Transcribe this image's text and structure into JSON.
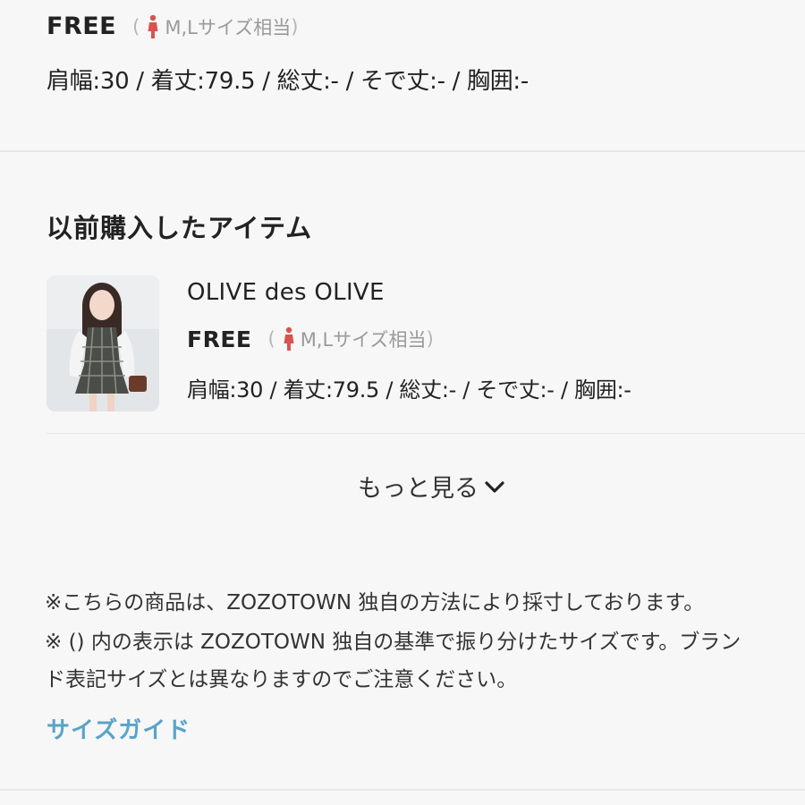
{
  "top_item": {
    "size": "FREE",
    "equiv_open": "(",
    "equiv_text": "M,Lサイズ相当",
    "equiv_close": ")",
    "measurements": "肩幅:30 / 着丈:79.5 / 総丈:- / そで丈:- / 胸囲:-"
  },
  "previous": {
    "title": "以前購入したアイテム",
    "item": {
      "brand": "OLIVE des OLIVE",
      "size": "FREE",
      "equiv_open": "(",
      "equiv_text": "M,Lサイズ相当",
      "equiv_close": ")",
      "measurements": "肩幅:30 / 着丈:79.5 / 総丈:- / そで丈:- / 胸囲:-"
    },
    "more_label": "もっと見る"
  },
  "notes": {
    "line1": "※こちらの商品は、ZOZOTOWN 独自の方法により採寸しております。",
    "line2": "※ () 内の表示は ZOZOTOWN 独自の基準で振り分けたサイズです。ブラン",
    "line3": "ド表記サイズとは異なりますのでご注意ください。"
  },
  "size_guide_label": "サイズガイド",
  "colors": {
    "background": "#f7f7f7",
    "person_icon": "#d9534f",
    "link": "#5aa3c8"
  },
  "icons": {
    "person": "female-person-icon",
    "chevron": "chevron-down-icon"
  }
}
